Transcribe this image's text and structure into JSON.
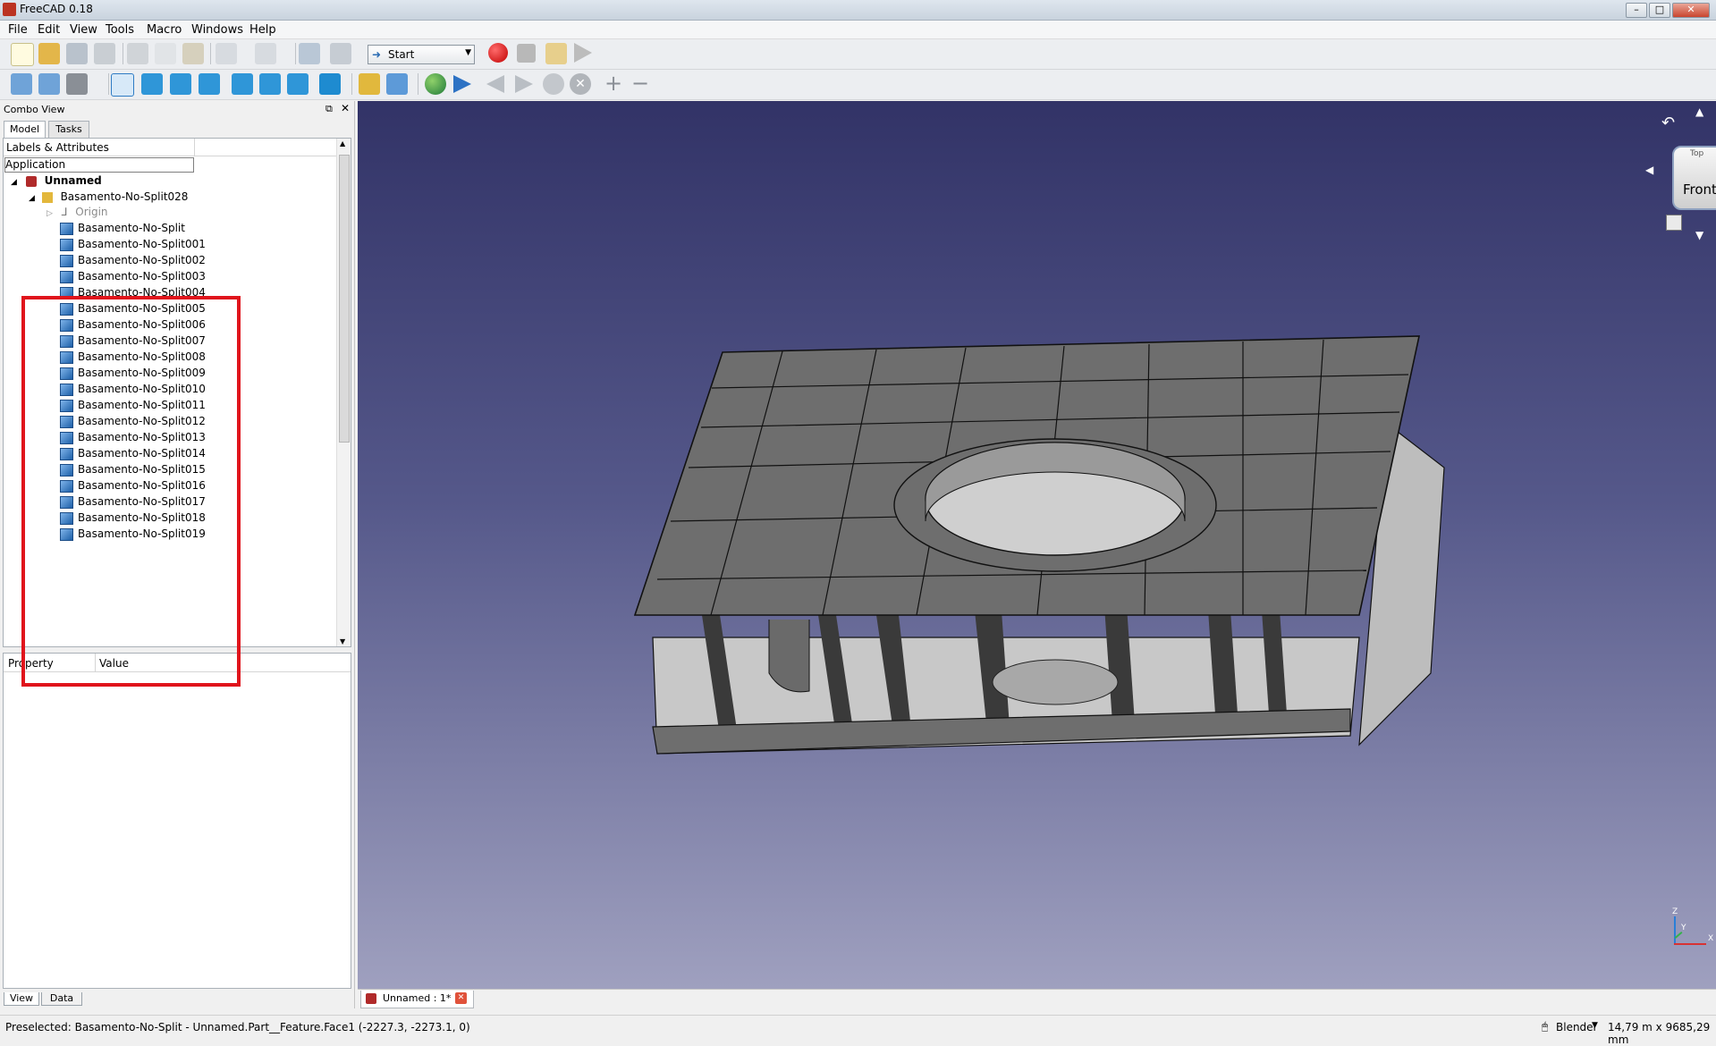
{
  "window": {
    "title": "FreeCAD 0.18"
  },
  "menu": [
    "File",
    "Edit",
    "View",
    "Tools",
    "Macro",
    "Windows",
    "Help"
  ],
  "toolbar": {
    "workbench": "Start"
  },
  "combo": {
    "title": "Combo View",
    "tabs": [
      "Model",
      "Tasks"
    ],
    "tree_header": "Labels & Attributes",
    "application": "Application",
    "document": "Unnamed",
    "group": "Basamento-No-Split028",
    "origin": "Origin",
    "items": [
      "Basamento-No-Split",
      "Basamento-No-Split001",
      "Basamento-No-Split002",
      "Basamento-No-Split003",
      "Basamento-No-Split004",
      "Basamento-No-Split005",
      "Basamento-No-Split006",
      "Basamento-No-Split007",
      "Basamento-No-Split008",
      "Basamento-No-Split009",
      "Basamento-No-Split010",
      "Basamento-No-Split011",
      "Basamento-No-Split012",
      "Basamento-No-Split013",
      "Basamento-No-Split014",
      "Basamento-No-Split015",
      "Basamento-No-Split016",
      "Basamento-No-Split017",
      "Basamento-No-Split018",
      "Basamento-No-Split019"
    ],
    "property_header": {
      "property": "Property",
      "value": "Value"
    },
    "bottom_tabs": [
      "View",
      "Data"
    ]
  },
  "navcube": {
    "face": "Front",
    "top": "Top"
  },
  "doc_tab": {
    "label": "Unnamed : 1*"
  },
  "status": {
    "preselected": "Preselected: Basamento-No-Split - Unnamed.Part__Feature.Face1 (-2227.3, -2273.1, 0)",
    "nav_style": "Blender",
    "dimensions": "14,79 m x 9685,29 mm"
  },
  "axes": {
    "x": "X",
    "y": "Y",
    "z": "Z"
  },
  "colors": {
    "highlight": "#e0141c",
    "face": "#6e6e6e",
    "face_light": "#c8c8c8"
  }
}
